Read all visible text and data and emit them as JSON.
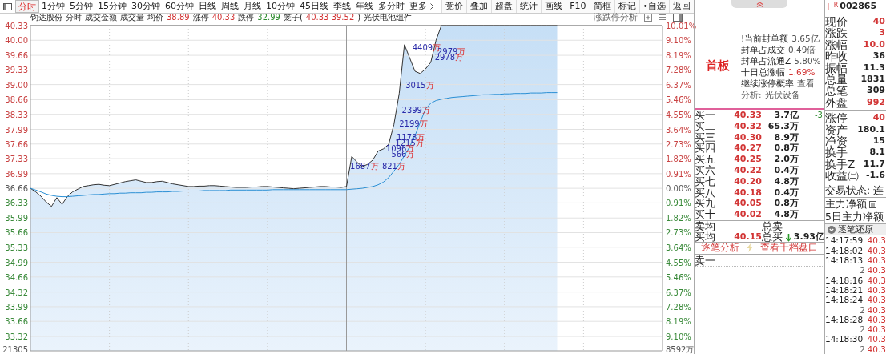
{
  "toolbar": {
    "periods": [
      {
        "label": "分时",
        "selected": true
      },
      {
        "label": "1分钟",
        "selected": false
      },
      {
        "label": "5分钟",
        "selected": false
      },
      {
        "label": "15分钟",
        "selected": false
      },
      {
        "label": "30分钟",
        "selected": false
      },
      {
        "label": "60分钟",
        "selected": false
      },
      {
        "label": "日线",
        "selected": false
      },
      {
        "label": "周线",
        "selected": false
      },
      {
        "label": "月线",
        "selected": false
      },
      {
        "label": "10分钟",
        "selected": false
      },
      {
        "label": "45日线",
        "selected": false
      },
      {
        "label": "季线",
        "selected": false
      },
      {
        "label": "年线",
        "selected": false
      },
      {
        "label": "多分时",
        "selected": false
      },
      {
        "label": "更多",
        "selected": false
      }
    ],
    "tools": [
      "竞价",
      "叠加",
      "超盘",
      "统计",
      "画线",
      "F10",
      "简框",
      "标记",
      "•自选",
      "返回"
    ]
  },
  "info_bar": {
    "segments": [
      {
        "text": "钧达股份"
      },
      {
        "text": "分时"
      },
      {
        "text": "成交金额"
      },
      {
        "text": "成交量"
      },
      {
        "text": "均价"
      },
      {
        "text": "38.89",
        "color": "#d23535"
      },
      {
        "text": "涨停"
      },
      {
        "text": "40.33",
        "color": "#d23535"
      },
      {
        "text": "跌停"
      },
      {
        "text": "32.99",
        "color": "#2e8b2e"
      },
      {
        "text": "笼子("
      },
      {
        "text": "40.33 39.52",
        "color": "#d23535"
      },
      {
        "text": ")"
      },
      {
        "text": "光伏电池组件"
      }
    ],
    "analysis": "涨跌停分析"
  },
  "chart": {
    "chart_data": {
      "type": "line",
      "grid": true,
      "ylim": [
        33.32,
        40.33
      ],
      "categories": [
        null,
        null,
        null,
        null,
        null,
        null,
        null,
        null,
        null,
        null,
        null,
        null,
        null,
        null,
        null,
        null,
        null,
        null,
        null,
        null,
        null,
        null,
        null,
        null,
        null,
        null,
        null,
        null,
        null,
        null,
        null,
        null,
        null,
        null,
        null,
        null,
        null,
        null,
        null,
        null,
        null,
        null,
        null,
        null,
        null,
        null,
        null,
        null,
        null,
        null,
        null,
        null,
        null,
        null,
        null,
        null,
        null,
        null,
        null,
        null,
        null,
        null,
        null,
        null,
        null,
        null,
        null,
        null,
        null,
        null,
        null,
        null,
        null,
        null,
        null,
        null,
        null,
        null,
        null,
        null,
        null,
        null,
        null,
        null,
        null,
        null,
        null,
        null,
        null,
        null,
        null,
        null,
        null,
        null,
        null,
        null,
        null,
        null,
        null,
        null,
        null,
        null,
        null,
        null,
        null,
        null,
        null,
        null,
        null,
        null,
        null,
        null,
        null,
        null,
        null,
        null,
        null,
        null,
        null,
        null,
        null
      ],
      "series": [
        {
          "type": "area",
          "color": "#333333",
          "values": [
            36.66,
            36.58,
            36.48,
            36.35,
            36.25,
            36.45,
            36.3,
            36.47,
            36.58,
            36.64,
            36.7,
            36.72,
            36.74,
            36.75,
            36.73,
            36.72,
            36.75,
            36.78,
            36.81,
            36.83,
            36.85,
            36.82,
            36.79,
            36.79,
            36.81,
            36.82,
            36.79,
            36.76,
            36.74,
            36.72,
            36.7,
            36.7,
            36.71,
            36.71,
            36.72,
            36.72,
            36.71,
            36.7,
            36.69,
            36.68,
            36.68,
            36.68,
            36.69,
            36.69,
            36.7,
            36.7,
            36.69,
            36.68,
            36.67,
            36.66,
            36.65,
            36.66,
            36.67,
            36.68,
            36.69,
            36.7,
            36.7,
            36.69,
            36.69,
            36.68,
            36.7,
            37.38,
            37.25,
            37.15,
            37.2,
            37.3,
            37.5,
            37.55,
            37.65,
            38.1,
            38.8,
            39.9,
            39.6,
            39.3,
            39.25,
            39.35,
            39.5,
            40.0,
            40.33,
            40.33,
            40.33,
            40.33,
            40.33,
            40.33,
            40.33,
            40.33,
            40.33,
            40.33,
            40.33,
            40.33,
            40.33,
            40.33,
            40.33,
            40.33,
            40.33,
            40.33,
            40.33,
            40.33,
            40.33,
            40.33,
            40.33,
            null,
            null,
            null,
            null,
            null,
            null,
            null,
            null,
            null,
            null,
            null,
            null,
            null,
            null,
            null,
            null,
            null,
            null,
            null,
            null
          ]
        },
        {
          "type": "line",
          "color": "#2a8fd4",
          "values": [
            36.66,
            36.62,
            36.58,
            36.53,
            36.5,
            36.48,
            36.47,
            36.47,
            36.48,
            36.49,
            36.5,
            36.51,
            36.52,
            36.52,
            36.53,
            36.54,
            36.54,
            36.55,
            36.55,
            36.56,
            36.56,
            36.56,
            36.57,
            36.57,
            36.58,
            36.58,
            36.58,
            36.59,
            36.59,
            36.6,
            36.6,
            36.6,
            36.6,
            36.61,
            36.61,
            36.61,
            36.61,
            36.61,
            36.62,
            36.62,
            36.62,
            36.62,
            36.62,
            36.62,
            36.62,
            36.62,
            36.63,
            36.63,
            36.63,
            36.63,
            36.63,
            36.63,
            36.63,
            36.63,
            36.63,
            36.63,
            36.63,
            36.63,
            36.63,
            36.63,
            36.63,
            36.64,
            36.65,
            36.66,
            36.68,
            36.7,
            36.74,
            36.8,
            36.9,
            37.05,
            37.2,
            37.4,
            37.6,
            37.85,
            38.15,
            38.45,
            38.58,
            38.64,
            38.67,
            38.69,
            38.71,
            38.72,
            38.73,
            38.74,
            38.75,
            38.76,
            38.77,
            38.77,
            38.78,
            38.78,
            38.79,
            38.79,
            38.8,
            38.8,
            38.8,
            38.81,
            38.81,
            38.81,
            38.82,
            38.82,
            38.82,
            null,
            null,
            null,
            null,
            null,
            null,
            null,
            null,
            null,
            null,
            null,
            null,
            null,
            null,
            null,
            null,
            null,
            null,
            null,
            null
          ]
        }
      ],
      "yticks": [
        {
          "value": 40.33,
          "label": "40.33"
        },
        {
          "value": 40.0,
          "label": "40.00"
        },
        {
          "value": 39.66,
          "label": "39.66"
        },
        {
          "value": 39.33,
          "label": "39.33"
        },
        {
          "value": 39.0,
          "label": "39.00"
        },
        {
          "value": 38.66,
          "label": "38.66"
        },
        {
          "value": 38.33,
          "label": "38.33"
        },
        {
          "value": 37.99,
          "label": "37.99"
        },
        {
          "value": 37.66,
          "label": "37.66"
        },
        {
          "value": 37.33,
          "label": "37.33"
        },
        {
          "value": 36.99,
          "label": "36.99"
        },
        {
          "value": 36.66,
          "label": "36.66"
        },
        {
          "value": 36.33,
          "label": "36.33"
        },
        {
          "value": 35.99,
          "label": "35.99"
        },
        {
          "value": 35.66,
          "label": "35.66"
        },
        {
          "value": 35.33,
          "label": "35.33"
        },
        {
          "value": 34.99,
          "label": "34.99"
        },
        {
          "value": 34.66,
          "label": "34.66"
        },
        {
          "value": 34.32,
          "label": "34.32"
        },
        {
          "value": 33.99,
          "label": "33.99"
        },
        {
          "value": 33.66,
          "label": "33.66"
        },
        {
          "value": 33.32,
          "label": "33.32"
        }
      ]
    },
    "deal_labels": [
      {
        "amount": "4409",
        "unit": "万"
      },
      {
        "amount": "2979",
        "unit": "万"
      },
      {
        "amount": "2978",
        "unit": "万"
      },
      {
        "amount": "3015",
        "unit": "万"
      },
      {
        "amount": "2399",
        "unit": "万"
      },
      {
        "amount": "2199",
        "unit": "万"
      },
      {
        "amount": "1178",
        "unit": "万"
      },
      {
        "amount": "1215",
        "unit": "万"
      },
      {
        "amount": "1096",
        "unit": "万"
      },
      {
        "amount": "566",
        "unit": "万"
      },
      {
        "amount": "1687",
        "unit": "万"
      },
      {
        "amount": "821",
        "unit": "万"
      }
    ],
    "percent_labels": [
      {
        "text": "10.01%",
        "color": "#c94343"
      },
      {
        "text": "9.10%",
        "color": "#c94343"
      },
      {
        "text": "8.19%",
        "color": "#c94343"
      },
      {
        "text": "7.28%",
        "color": "#c94343"
      },
      {
        "text": "6.37%",
        "color": "#c94343"
      },
      {
        "text": "5.46%",
        "color": "#c94343"
      },
      {
        "text": "4.55%",
        "color": "#c94343"
      },
      {
        "text": "3.64%",
        "color": "#c94343"
      },
      {
        "text": "2.73%",
        "color": "#c94343"
      },
      {
        "text": "1.82%",
        "color": "#c94343"
      },
      {
        "text": "0.91%",
        "color": "#c94343"
      },
      {
        "text": "0.00%"
      },
      {
        "text": "0.91%",
        "color": "#3a8a3a"
      },
      {
        "text": "1.82%",
        "color": "#3a8a3a"
      },
      {
        "text": "2.73%",
        "color": "#3a8a3a"
      },
      {
        "text": "3.64%",
        "color": "#3a8a3a"
      },
      {
        "text": "4.55%",
        "color": "#3a8a3a"
      },
      {
        "text": "5.46%",
        "color": "#3a8a3a"
      },
      {
        "text": "6.37%",
        "color": "#3a8a3a"
      },
      {
        "text": "7.28%",
        "color": "#3a8a3a"
      },
      {
        "text": "8.19%",
        "color": "#3a8a3a"
      },
      {
        "text": "9.10%",
        "color": "#3a8a3a"
      }
    ],
    "volume_label": "21305",
    "amount_label": "8592万"
  },
  "limit_panel": {
    "badge": "首板",
    "lines": [
      {
        "label": "!当前封单额",
        "value": "3.65亿",
        "muted": false,
        "highlight": false
      },
      {
        "label": "封单占成交",
        "value": "0.49倍",
        "muted": false,
        "highlight": false
      },
      {
        "label": "封单占流通Z",
        "value": "5.80%",
        "muted": false,
        "highlight": false
      },
      {
        "label": "十日总涨幅",
        "value": "1.69%",
        "muted": false,
        "highlight": true
      },
      {
        "label": "继续涨停概率",
        "value": "查看",
        "muted": false,
        "highlight": false
      },
      {
        "label": "分析:",
        "value": "光伏设备",
        "muted": true,
        "highlight": false
      }
    ]
  },
  "bids": [
    {
      "name": "买一",
      "price": "40.33",
      "volume": "3.7亿",
      "change": "-3"
    },
    {
      "name": "买二",
      "price": "40.32",
      "volume": "65.3万"
    },
    {
      "name": "买三",
      "price": "40.30",
      "volume": "8.9万"
    },
    {
      "name": "买四",
      "price": "40.27",
      "volume": "0.8万"
    },
    {
      "name": "买五",
      "price": "40.25",
      "volume": "2.0万"
    },
    {
      "name": "买六",
      "price": "40.22",
      "volume": "0.4万"
    },
    {
      "name": "买七",
      "price": "40.20",
      "volume": "4.8万"
    },
    {
      "name": "买八",
      "price": "40.18",
      "volume": "0.4万"
    },
    {
      "name": "买九",
      "price": "40.05",
      "volume": "0.8万"
    },
    {
      "name": "买十",
      "price": "40.02",
      "volume": "4.8万"
    }
  ],
  "summary": [
    {
      "label": "卖均",
      "total_label": "总卖",
      "falling": false
    },
    {
      "label": "买均",
      "price": "40.15",
      "total_label": "总买",
      "falling": true,
      "total": "3.93亿"
    }
  ],
  "actions": [
    "逐笔分析",
    "查看千档盘口"
  ],
  "asks": [
    {
      "name": "卖一"
    }
  ],
  "quote": {
    "l_mark": "L",
    "r_mark": "R",
    "code": "002865",
    "rows": [
      {
        "label": "现价",
        "value": "40",
        "up": true
      },
      {
        "label": "涨跌",
        "value": "3",
        "up": true
      },
      {
        "label": "涨幅",
        "value": "10.0",
        "up": true
      },
      {
        "label": "昨收",
        "value": "36",
        "up": false
      },
      {
        "label": "振幅",
        "value": "11.3",
        "up": false
      },
      {
        "label": "总量",
        "value": "1831",
        "up": false
      },
      {
        "label": "总笔",
        "value": "309",
        "up": false
      },
      {
        "label": "外盘",
        "value": "992",
        "up": true
      }
    ],
    "rows2": [
      {
        "label": "涨停",
        "value": "40",
        "up": true
      },
      {
        "label": "资产",
        "value": "180.1",
        "up": false
      },
      {
        "label": "净资",
        "value": "15",
        "up": false
      },
      {
        "label": "换手",
        "value": "8.1",
        "up": false
      },
      {
        "label": "换手Z",
        "value": "11.7",
        "up": false
      },
      {
        "label": "收益㈡",
        "value": "-1.6",
        "up": false
      }
    ],
    "status": "交易状态: 连",
    "flows": [
      {
        "label": "主力净额"
      },
      {
        "label": "5日主力净额"
      }
    ],
    "ticks_title": "逐笔还原",
    "ticks": [
      {
        "time": "14:17:59",
        "price": "40.3"
      },
      {
        "time": "14:18:02",
        "price": "40.3"
      },
      {
        "time": "14:18:13",
        "price": "40.3"
      },
      {
        "count": "2",
        "price": "40.3"
      },
      {
        "time": "14:18:16",
        "price": "40.3"
      },
      {
        "time": "14:18:21",
        "price": "40.3"
      },
      {
        "time": "14:18:24",
        "price": "40.3"
      },
      {
        "count": "2",
        "price": "40.3"
      },
      {
        "time": "14:18:28",
        "price": "40.3"
      },
      {
        "count": "2",
        "price": "40.3"
      },
      {
        "time": "14:18:30",
        "price": "40.3"
      },
      {
        "count": "2",
        "price": "40.3"
      }
    ]
  }
}
